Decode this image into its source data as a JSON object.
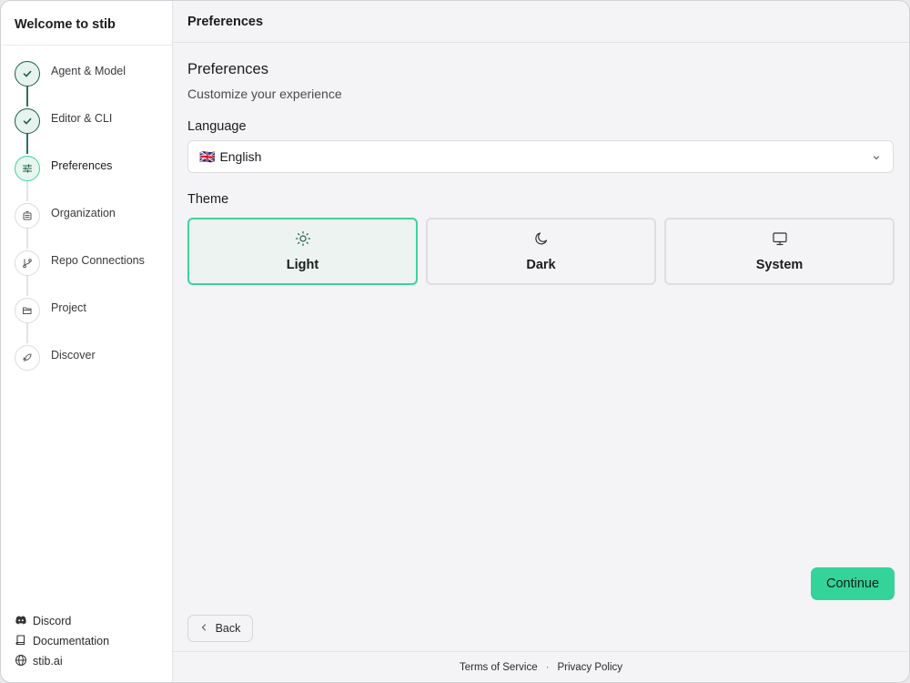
{
  "sidebar": {
    "title": "Welcome to stib",
    "steps": [
      {
        "label": "Agent & Model",
        "state": "done",
        "icon": "check-icon"
      },
      {
        "label": "Editor & CLI",
        "state": "done",
        "icon": "check-icon"
      },
      {
        "label": "Preferences",
        "state": "current",
        "icon": "sliders-icon"
      },
      {
        "label": "Organization",
        "state": "pending",
        "icon": "building-icon"
      },
      {
        "label": "Repo Connections",
        "state": "pending",
        "icon": "git-branch-icon"
      },
      {
        "label": "Project",
        "state": "pending",
        "icon": "folder-open-icon"
      },
      {
        "label": "Discover",
        "state": "pending",
        "icon": "rocket-icon"
      }
    ],
    "footer_links": [
      {
        "label": "Discord",
        "icon": "discord-icon"
      },
      {
        "label": "Documentation",
        "icon": "book-icon"
      },
      {
        "label": "stib.ai",
        "icon": "globe-icon"
      }
    ]
  },
  "header": {
    "title": "Preferences"
  },
  "main": {
    "section_title": "Preferences",
    "section_subtitle": "Customize your experience",
    "language": {
      "label": "Language",
      "selected_flag": "🇬🇧",
      "selected": "English"
    },
    "theme": {
      "label": "Theme",
      "options": [
        {
          "label": "Light",
          "icon": "sun-icon",
          "selected": true
        },
        {
          "label": "Dark",
          "icon": "moon-icon",
          "selected": false
        },
        {
          "label": "System",
          "icon": "monitor-icon",
          "selected": false
        }
      ]
    },
    "continue_label": "Continue",
    "back_label": "Back"
  },
  "footer": {
    "terms": "Terms of Service",
    "separator": "·",
    "privacy": "Privacy Policy"
  },
  "colors": {
    "accent": "#34d39a",
    "done_step": "#1f5f4c"
  }
}
